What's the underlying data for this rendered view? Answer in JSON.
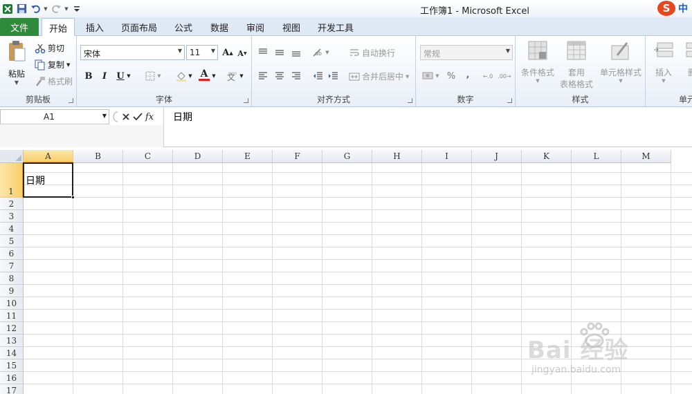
{
  "window": {
    "title": "工作簿1 - Microsoft Excel",
    "ime": {
      "logo": "S",
      "mode": "中"
    }
  },
  "tabs": {
    "file": "文件",
    "items": [
      "开始",
      "插入",
      "页面布局",
      "公式",
      "数据",
      "审阅",
      "视图",
      "开发工具"
    ],
    "active": "开始"
  },
  "ribbon": {
    "clipboard": {
      "paste": "粘贴",
      "cut": "剪切",
      "copy": "复制",
      "format_painter": "格式刷",
      "label": "剪贴板"
    },
    "font": {
      "name": "宋体",
      "size": "11",
      "bold": "B",
      "italic": "I",
      "underline": "U",
      "font_color_letter": "A",
      "label": "字体"
    },
    "alignment": {
      "wrap": "自动换行",
      "merge": "合并后居中",
      "label": "对齐方式"
    },
    "number": {
      "format": "常规",
      "percent": "%",
      "comma": ",",
      "label": "数字"
    },
    "styles": {
      "conditional": "条件格式",
      "table_format_1": "套用",
      "table_format_2": "表格格式",
      "cell_styles": "单元格样式",
      "label": "样式"
    },
    "cells": {
      "insert": "插入",
      "delete": "删",
      "label": "单元"
    }
  },
  "formula_bar": {
    "name_box": "A1",
    "fx": "fx",
    "content": "日期"
  },
  "sheet": {
    "columns": [
      "A",
      "B",
      "C",
      "D",
      "E",
      "F",
      "G",
      "H",
      "I",
      "J",
      "K",
      "L",
      "M"
    ],
    "rows": [
      "1",
      "2",
      "3",
      "4",
      "5",
      "6",
      "7",
      "8",
      "9",
      "10",
      "11",
      "12",
      "13",
      "14",
      "15",
      "16",
      "17"
    ],
    "selected_column": "A",
    "selected_row": "1",
    "cells": {
      "A1": "日期"
    }
  },
  "watermark": {
    "main": "Bai 经验",
    "sub": "jingyan.baidu.com"
  },
  "colors": {
    "file_tab": "#2e8b3a",
    "selection_header": "#f7cf6a",
    "ime": "#e8461d"
  }
}
